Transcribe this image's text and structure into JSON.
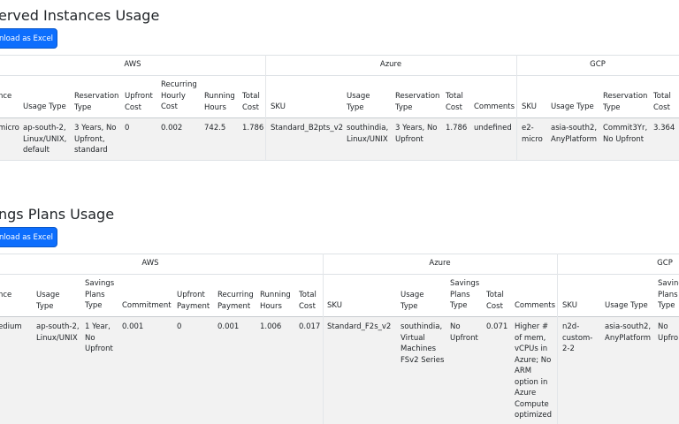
{
  "reserved": {
    "title": "erved Instances Usage",
    "download_label": "nload as Excel",
    "groups": [
      "AWS",
      "Azure",
      "GCP"
    ],
    "headers": [
      "nce",
      "Usage Type",
      "Reservation Type",
      "Upfront Cost",
      "Recurring Hourly Cost",
      "Running Hours",
      "Total Cost",
      "SKU",
      "Usage Type",
      "Reservation Type",
      "Total Cost",
      "Comments",
      "SKU",
      "Usage Type",
      "Reservation Type",
      "Total Cost"
    ],
    "row": [
      "micro",
      "ap-south-2, Linux/UNIX, default",
      "3 Years, No Upfront, standard",
      "0",
      "0.002",
      "742.5",
      "1.786",
      "Standard_B2pts_v2",
      "southindia, Linux/UNIX",
      "3 Years, No Upfront",
      "1.786",
      "undefined",
      "e2-micro",
      "asia-south2, AnyPlatform",
      "Commit3Yr, No Upfront",
      "3.364"
    ]
  },
  "savings": {
    "title": "ngs Plans Usage",
    "download_label": "nload as Excel",
    "groups": [
      "AWS",
      "Azure",
      "GCP"
    ],
    "headers": [
      "nce",
      "Usage Type",
      "Savings Plans Type",
      "Commitment",
      "Upfront Payment",
      "Recurring Payment",
      "Running Hours",
      "Total Cost",
      "SKU",
      "Usage Type",
      "Savings Plans Type",
      "Total Cost",
      "Comments",
      "SKU",
      "Usage Type",
      "Saving Plans Type"
    ],
    "row": [
      "edium",
      "ap-south-2, Linux/UNIX",
      "1 Year, No Upfront",
      "0.001",
      "0",
      "0.001",
      "1.006",
      "0.017",
      "Standard_F2s_v2",
      "southindia, Virtual Machines FSv2 Series",
      "No Upfront",
      "0.071",
      "Higher # of mem, vCPUs in Azure; No ARM option in Azure Compute optimized",
      "n2d-custom-2-2",
      "asia-south2, AnyPlatform",
      "No Upfro"
    ]
  }
}
